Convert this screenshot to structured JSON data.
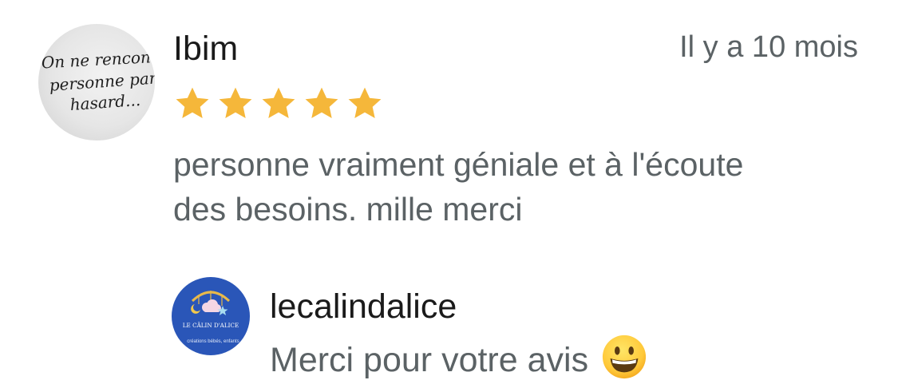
{
  "review": {
    "author": "Ibim",
    "avatar_text": [
      "On ne rencont",
      "personne par",
      "hasard..."
    ],
    "date": "Il y a 10 mois",
    "rating": 5,
    "rating_max": 5,
    "star_color": "#F5B73A",
    "text": "personne vraiment géniale et à l'écoute des besoins. mille merci"
  },
  "reply": {
    "author": "lecalindalice",
    "avatar_brand": "LE CÂLIN D'ALICE",
    "avatar_tagline": "créations bébés, enfants",
    "avatar_color": "#2A56B8",
    "text": "Merci pour votre avis",
    "emoji": "grinning-face-emoji"
  }
}
